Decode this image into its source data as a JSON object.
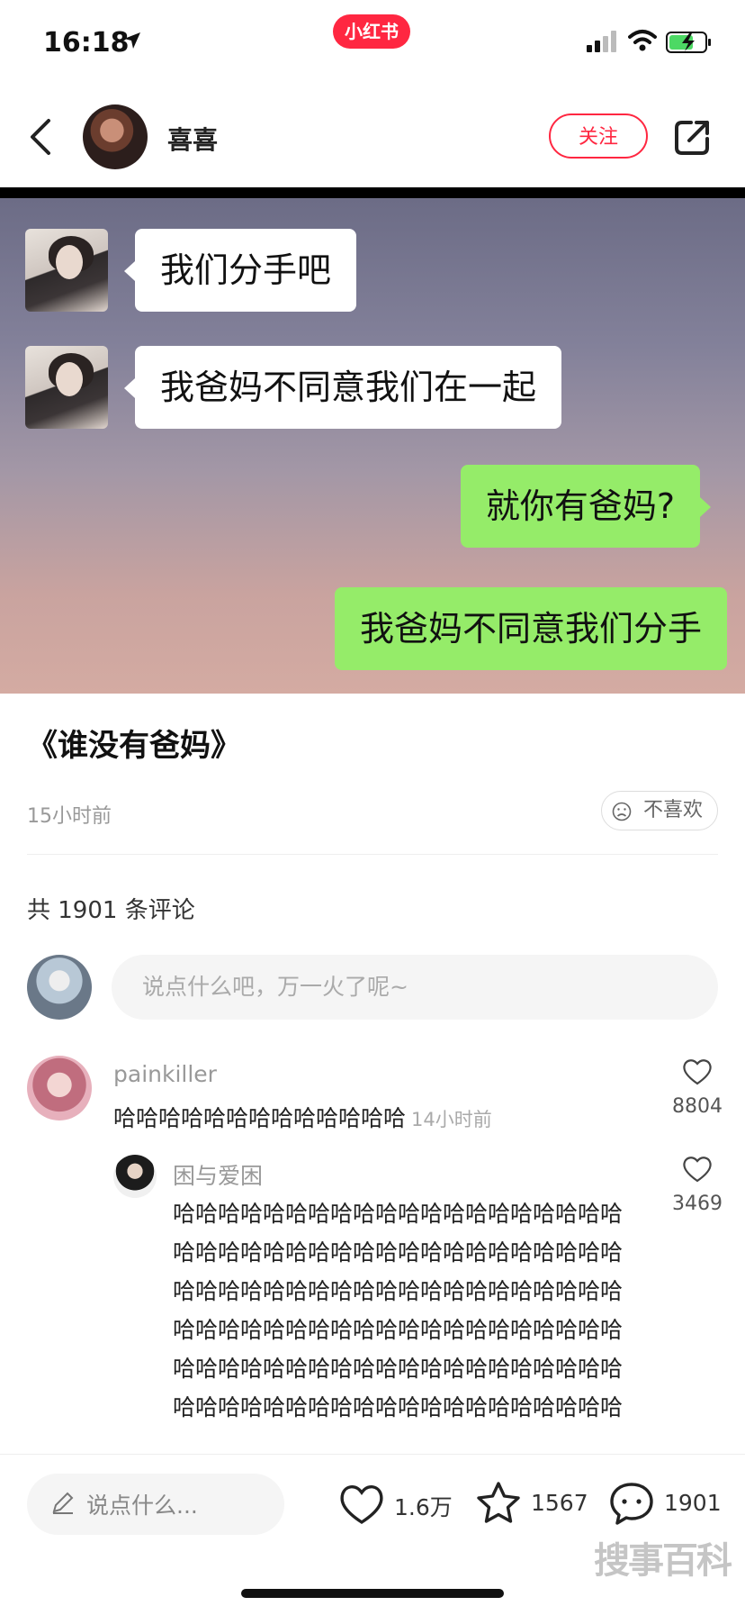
{
  "status_bar": {
    "time": "16:18"
  },
  "app_badge": "小红书",
  "header": {
    "author": "喜喜",
    "follow_label": "关注"
  },
  "post_image": {
    "messages": [
      {
        "side": "left",
        "text": "我们分手吧"
      },
      {
        "side": "left",
        "text": "我爸妈不同意我们在一起"
      },
      {
        "side": "right",
        "text": "就你有爸妈?"
      },
      {
        "side": "right",
        "text": "我爸妈不同意我们分手"
      }
    ]
  },
  "post": {
    "title": "《谁没有爸妈》",
    "time": "15小时前",
    "dislike_label": "不喜欢"
  },
  "comments_section": {
    "count_label": "共 1901 条评论",
    "input_placeholder": "说点什么吧，万一火了呢~"
  },
  "comments": [
    {
      "user": "painkiller",
      "text": "哈哈哈哈哈哈哈哈哈哈哈哈哈",
      "time": "14小时前",
      "likes": "8804"
    },
    {
      "user": "困与爱困",
      "text": "哈哈哈哈哈哈哈哈哈哈哈哈哈哈哈哈哈哈哈哈哈哈哈哈哈哈哈哈哈哈哈哈哈哈哈哈哈哈哈哈哈哈哈哈哈哈哈哈哈哈哈哈哈哈哈哈哈哈哈哈哈哈哈哈哈哈哈哈哈哈哈哈哈哈哈哈哈哈哈哈哈哈哈哈哈哈哈哈哈哈哈哈哈哈哈哈哈哈哈哈哈哈哈哈哈哈哈哈哈哈哈哈哈哈哈哈哈哈哈哈",
      "likes": "3469"
    }
  ],
  "bottom_bar": {
    "input_placeholder": "说点什么...",
    "likes": "1.6万",
    "favorites": "1567",
    "comments": "1901"
  },
  "watermark": "搜事百科",
  "colors": {
    "brand": "#ff2741",
    "bubble_green": "#95ec69"
  }
}
